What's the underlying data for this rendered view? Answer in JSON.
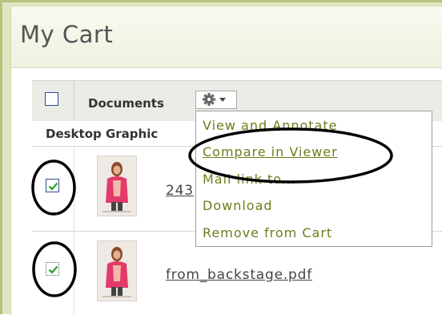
{
  "page": {
    "title": "My Cart"
  },
  "table": {
    "header": {
      "documents_label": "Documents",
      "gear_icon": "gear-icon",
      "dropdown_icon": "caret-down-icon"
    },
    "subheader": {
      "desktop_graphic_label": "Desktop Graphic"
    },
    "rows": [
      {
        "checked": true,
        "file_name": "243"
      },
      {
        "checked": true,
        "file_name": "from_backstage.pdf"
      }
    ]
  },
  "menu": {
    "items": [
      {
        "label": "View and Annotate"
      },
      {
        "label": "Compare in Viewer"
      },
      {
        "label": "Mail link to..."
      },
      {
        "label": "Download"
      },
      {
        "label": "Remove from Cart"
      }
    ]
  },
  "colors": {
    "menu_text": "#6c7d1c",
    "checkbox_border": "#2e4a8f",
    "check_mark": "#2aa52a",
    "annotation": "#000000"
  }
}
